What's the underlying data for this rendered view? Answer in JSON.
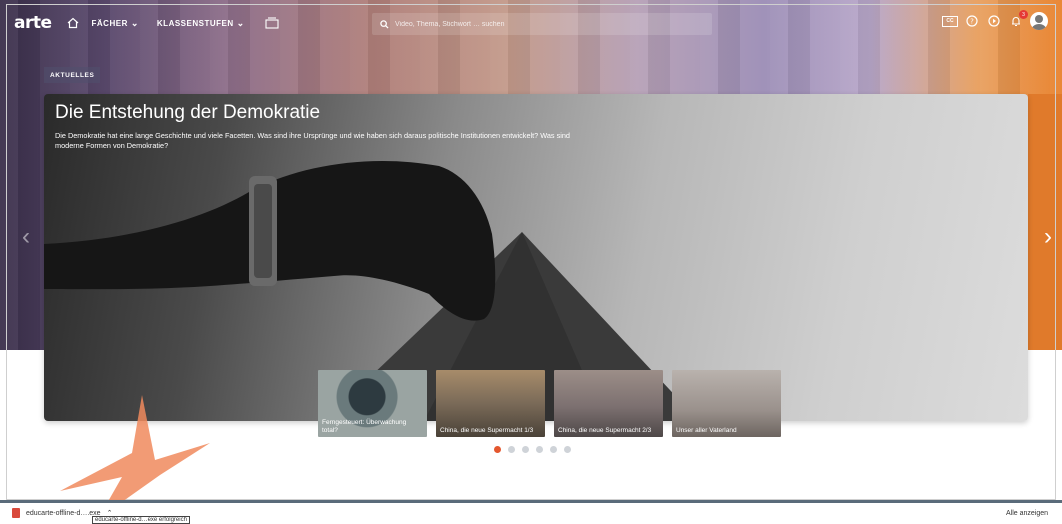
{
  "header": {
    "logo": "arte",
    "nav": [
      {
        "label": "FÄCHER"
      },
      {
        "label": "KLASSENSTUFEN"
      }
    ],
    "search_placeholder": "Video, Thema, Stichwort … suchen",
    "cc_label": "CC",
    "notification_count": "3"
  },
  "section_tag": "AKTUELLES",
  "feature": {
    "title": "Die Entstehung der Demokratie",
    "description": "Die Demokratie hat eine lange Geschichte und viele Facetten. Was sind ihre Ursprünge und wie haben sich daraus politische Institutionen entwickelt? Was sind moderne Formen von Demokratie?"
  },
  "thumbnails": [
    {
      "label": "Ferngesteuert: Überwachung total?"
    },
    {
      "label": "China, die neue Supermacht 1/3"
    },
    {
      "label": "China, die neue Supermacht 2/3"
    },
    {
      "label": "Unser aller Vaterland"
    }
  ],
  "carousel": {
    "count": 6,
    "active": 0
  },
  "download_bar": {
    "file": "educarte-offline-d….exe",
    "tooltip": "educarte-offline-d…exe erfolgreich",
    "show_all": "Alle anzeigen"
  },
  "colors": {
    "accent": "#e4572e",
    "orange_panel": "#e07a2b",
    "download_border": "#5a6b7a"
  }
}
